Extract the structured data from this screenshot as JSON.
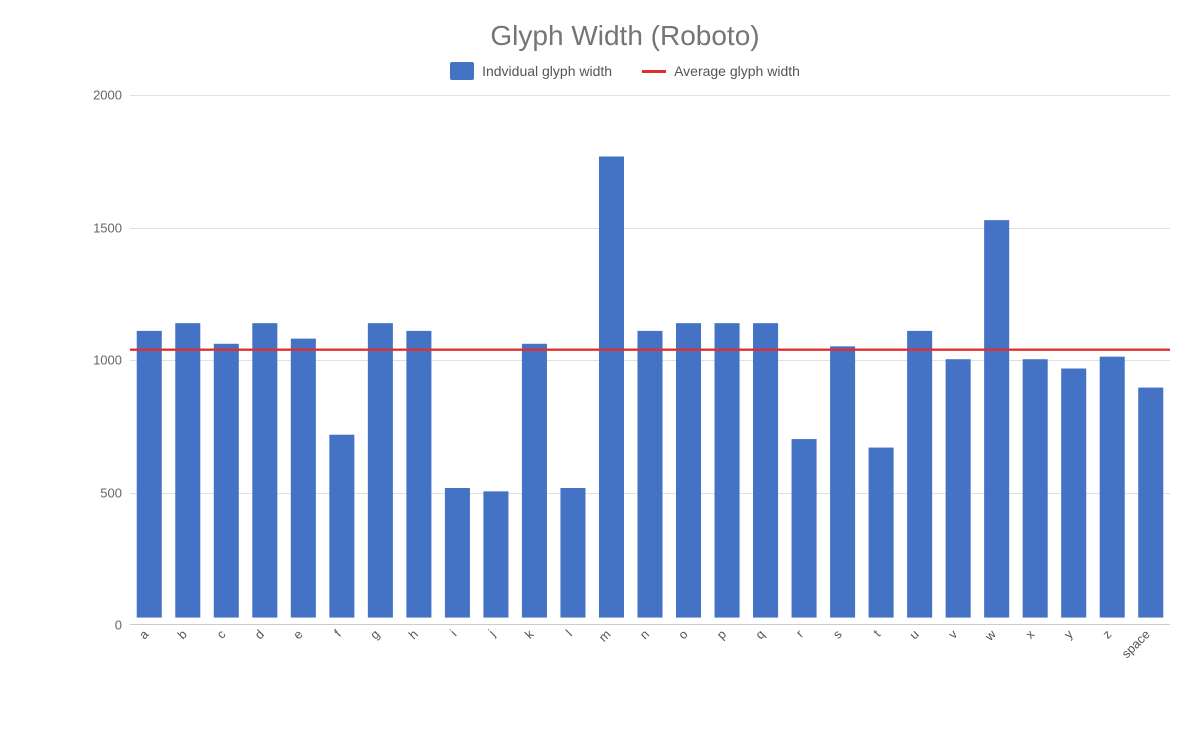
{
  "title": "Glyph Width (Roboto)",
  "legend": {
    "bar_label": "Indvidual glyph width",
    "line_label": "Average glyph width"
  },
  "chart": {
    "y_max": 2000,
    "y_ticks": [
      0,
      500,
      1000,
      1500,
      2000
    ],
    "average_value": 1040,
    "bar_color": "#4472C4",
    "avg_line_color": "#E03030",
    "bars": [
      {
        "label": "a",
        "value": 1113
      },
      {
        "label": "b",
        "value": 1143
      },
      {
        "label": "c",
        "value": 1063
      },
      {
        "label": "d",
        "value": 1143
      },
      {
        "label": "e",
        "value": 1083
      },
      {
        "label": "f",
        "value": 710
      },
      {
        "label": "g",
        "value": 1143
      },
      {
        "label": "h",
        "value": 1113
      },
      {
        "label": "i",
        "value": 503
      },
      {
        "label": "j",
        "value": 490
      },
      {
        "label": "k",
        "value": 1063
      },
      {
        "label": "l",
        "value": 503
      },
      {
        "label": "m",
        "value": 1790
      },
      {
        "label": "n",
        "value": 1113
      },
      {
        "label": "o",
        "value": 1143
      },
      {
        "label": "p",
        "value": 1143
      },
      {
        "label": "q",
        "value": 1143
      },
      {
        "label": "r",
        "value": 693
      },
      {
        "label": "s",
        "value": 1053
      },
      {
        "label": "t",
        "value": 660
      },
      {
        "label": "u",
        "value": 1113
      },
      {
        "label": "v",
        "value": 1003
      },
      {
        "label": "w",
        "value": 1543
      },
      {
        "label": "x",
        "value": 1003
      },
      {
        "label": "y",
        "value": 967
      },
      {
        "label": "z",
        "value": 1013
      },
      {
        "label": "space",
        "value": 893
      }
    ]
  }
}
